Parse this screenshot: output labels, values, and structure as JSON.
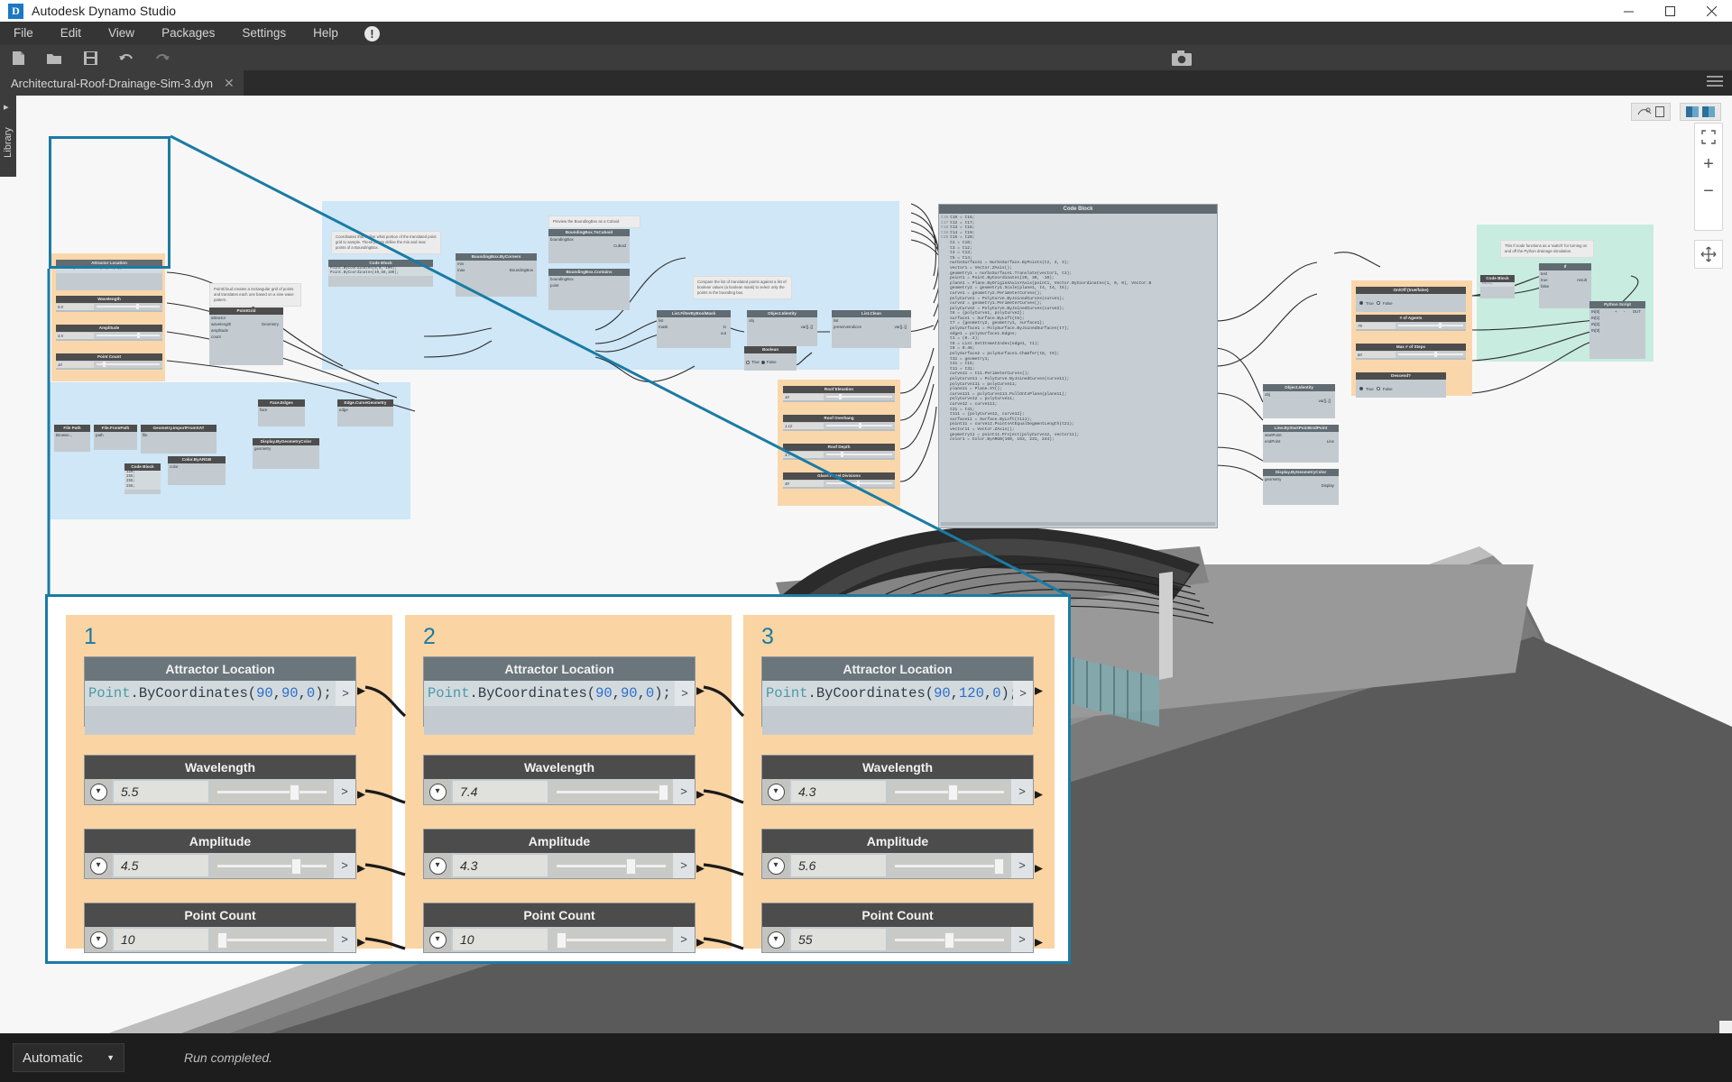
{
  "window": {
    "title": "Autodesk Dynamo Studio",
    "logo_letter": "D",
    "minimize": "─",
    "maximize": "☐",
    "close": "✕"
  },
  "menubar": {
    "items": [
      "File",
      "Edit",
      "View",
      "Packages",
      "Settings",
      "Help"
    ],
    "alert_icon": "!"
  },
  "toolbar": {
    "icons": [
      "new-file-icon",
      "open-folder-icon",
      "save-icon",
      "undo-icon",
      "redo-icon"
    ],
    "camera_icon": "camera-icon"
  },
  "tabbar": {
    "document_name": "Architectural-Roof-Drainage-Sim-3.dyn",
    "close_glyph": "✕"
  },
  "library_panel": {
    "label": "Library",
    "expand_glyph": "▸"
  },
  "canvas": {
    "groups": [
      {
        "name": "attractor-group-1",
        "color": "#fad7ab"
      },
      {
        "name": "sampling-group",
        "color": "#cfe7f7"
      },
      {
        "name": "import-group",
        "color": "#cfe7f7"
      },
      {
        "name": "roof-params-group",
        "color": "#fad7ab"
      },
      {
        "name": "simulation-group",
        "color": "#fad7ab"
      },
      {
        "name": "python-group",
        "color": "#c8ece0"
      }
    ],
    "mini_nodes": {
      "attractor": {
        "code_title": "Attractor Location",
        "code_text": "Point.ByCoordinates(90,90,0);",
        "sliders": [
          {
            "label": "Wavelength",
            "value": "5.5",
            "pct": 62
          },
          {
            "label": "Amplitude",
            "value": "4.5",
            "pct": 64
          },
          {
            "label": "Point Count",
            "value": "10",
            "pct": 10
          }
        ]
      },
      "sampling": {
        "note1": "Coordinates that define what portion of the translated point grid to sample. These points define the min and max points of a BoundingBox.",
        "note2": "Preview the BoundingBox as a Cuboid",
        "note3": "Compare the list of translated points against a list of boolean values (a boolean mask) to select only the points in the bounding box.",
        "code_block_title": "Code Block",
        "code_lines": [
          "Point.ByCoordinates(0,0,-100);",
          "Point.ByCoordinates(40,60,100);"
        ],
        "nodes": [
          {
            "title": "BoundingBox.ByCorners",
            "inputs": [
              "min",
              "max"
            ],
            "outputs": [
              "BoundingBox"
            ]
          },
          {
            "title": "BoundingBox.ToCuboid",
            "inputs": [
              "boundingBox"
            ],
            "outputs": [
              "Cuboid"
            ]
          },
          {
            "title": "BoundingBox.Contains",
            "inputs": [
              "boundingBox",
              "point"
            ],
            "outputs": [
              "bool"
            ]
          },
          {
            "title": "List.FilterByBoolMask",
            "inputs": [
              "list",
              "mask"
            ],
            "outputs": [
              "in",
              "out"
            ]
          },
          {
            "title": "Object.Identity",
            "inputs": [
              "obj"
            ],
            "outputs": [
              "var[]..[]"
            ]
          },
          {
            "title": "List.Clean",
            "inputs": [
              "list",
              "preserveIndices"
            ],
            "outputs": [
              "var[]..[]"
            ]
          },
          {
            "title": "Boolean",
            "inputs": [],
            "outputs": [],
            "options": [
              "True",
              "False"
            ],
            "selected": "False"
          }
        ]
      },
      "import": {
        "note": "PointCloud creates a rectangular grid of points and translates each one based on a sine wave pattern.",
        "nodes": [
          {
            "title": "File Path",
            "rows": [
              "Browse..."
            ]
          },
          {
            "title": "File.FromPath",
            "rows": [
              "path",
              "file"
            ]
          },
          {
            "title": "Geometry.ImportFromSAT",
            "rows": [
              "file",
              "Geometry[]"
            ]
          },
          {
            "title": "Face.Edges",
            "rows": [
              "face",
              "Edge[]"
            ]
          },
          {
            "title": "Edge.CurveGeometry",
            "rows": [
              "edge",
              "Curve"
            ]
          },
          {
            "title": "Display.ByGeometryColor",
            "rows": [
              "geometry",
              "Display",
              "color"
            ]
          },
          {
            "title": "Color.ByARGB",
            "rows": [
              "a",
              "r",
              "g",
              "b",
              "color"
            ]
          },
          {
            "title": "Code Block",
            "rows": [
              "120;",
              "255;",
              "255;",
              "255;"
            ]
          },
          {
            "title": "PointGrid",
            "rows": [
              "attractor",
              "wavelength",
              "amplitude",
              "count",
              "Geometry"
            ]
          },
          {
            "title": "Display.ByGeometryColor",
            "rows": [
              "geometry",
              "color",
              "Display"
            ]
          }
        ]
      },
      "roof_params": {
        "sliders": [
          {
            "label": "Roof Elevation",
            "value": "10",
            "pct": 20
          },
          {
            "label": "Roof Overhang",
            "value": "1.12",
            "pct": 50
          },
          {
            "label": "Roof Depth",
            "value": "3.7",
            "pct": 22
          },
          {
            "label": "Glass Panel Divisions",
            "value": "49",
            "pct": 47
          }
        ]
      },
      "lower_right": [
        {
          "title": "Object.Identity",
          "rows": [
            "obj",
            "var[]..[]"
          ]
        },
        {
          "title": "Line.ByStartPointEndPoint",
          "rows": [
            "startPoint",
            "endPoint",
            "Line"
          ]
        },
        {
          "title": "Display.ByGeometryColor",
          "rows": [
            "geometry",
            "color",
            "Display"
          ]
        }
      ],
      "simulation": {
        "nodes": [
          {
            "title": "On/Off (true/false)",
            "type": "boolean",
            "options": [
              "True",
              "False"
            ],
            "selected": "True"
          },
          {
            "title": "# of Agents",
            "type": "slider",
            "value": "79",
            "pct": 62
          },
          {
            "title": "Max # of Steps",
            "type": "slider",
            "value": "60",
            "pct": 55
          },
          {
            "title": "Descend?",
            "type": "boolean",
            "options": [
              "True",
              "False"
            ],
            "selected": "True"
          }
        ]
      },
      "python": {
        "note": "This If node functions as a 'switch' for turning on and off the Python drainage simulation.",
        "if_node": {
          "title": "If",
          "inputs": [
            "test",
            "true",
            "false"
          ],
          "outputs": [
            "result"
          ]
        },
        "code_block": {
          "title": "Code Block",
          "text": "null;"
        },
        "script_node": {
          "title": "Python Script",
          "inputs": [
            "IN[0]",
            "IN[1]",
            "IN[2]",
            "IN[3]"
          ],
          "outputs": [
            "OUT"
          ],
          "plus": "+",
          "minus": "-"
        }
      }
    },
    "big_code_block": {
      "title": "Code Block",
      "gutter": [
        "t16",
        "t17",
        "t18",
        "t19",
        "t20"
      ],
      "lines": [
        "t10 = t16;",
        "t12 = t17;",
        "t13 = t18;",
        "t14 = t19;",
        "t15 = t20;",
        "t2 = t10;",
        "t3 = t12;",
        "t4 = t13;",
        "t5 = t14;",
        "nurbsSurface1 = NurbsSurface.ByPoints(t2, 3, 3);",
        "vector1 = Vector.ZAxis();",
        "geometry1 = nurbsSurface1.Translate(vector1, t3);",
        "point1 = Point.ByCoordinates(20, 30, -10);",
        "plane1 = Plane.ByOriginXAxisYAxis(point1, Vector.ByCoordinates(1, 0, 0), Vector.B",
        "geometry2 = geometry1.Scale(plane1, t4, t4, t5);",
        "curve1 = geometry2.PerimeterCurves();",
        "polyCurve1 = PolyCurve.ByJoinedCurves(curve1);",
        "curve2 = geometry1.PerimeterCurves();",
        "polyCurve2 = PolyCurve.ByJoinedCurves(curve2);",
        "t6 = {polyCurve1, polyCurve2};",
        "surface1 = Surface.ByLoft(t6);",
        "t7 = {geometry2, geometry1, surface1};",
        "polySurface1 = PolySurface.ByJoinedSurfaces(t7);",
        "edge1 = polySurface1.Edges;",
        "t1 = (0..3);",
        "t8 = List.GetItemAtIndex(edge1, t1);",
        "t9 = 0.46;",
        "polySurface2 = polySurface1.Chamfer(t8, t9);",
        "t31 = geometry1;",
        "t41 = t15;",
        "t11 = t31;",
        "curve11 = t11.PerimeterCurves();",
        "polyCurve11 = PolyCurve.ByJoinedCurves(curve11);",
        "polyCurve111 = polyCurve11;",
        "plane11 = Plane.XY();",
        "curve111 = polyCurve111.PullOntoPlane(plane11);",
        "polyCurve12 = polyCurve11;",
        "curve12 = curve111;",
        "t21 = t41;",
        "t111 = {polyCurve12, curve12};",
        "surface11 = Surface.ByLoft(t111);",
        "point11 = curve12.PointsAtEqualSegmentLength(t21);",
        "vector11 = Vector.ZAxis();",
        "geometry11 = point11.Project(polyCurve12, vector11);",
        "color1 = Color.ByARGB(160, 163, 231, 244);"
      ]
    },
    "zoom_controls": {
      "fit_icon": "fit-to-screen-icon",
      "zoom_in": "+",
      "zoom_out": "−",
      "pan_icon": "pan-icon"
    },
    "top_right_icons": [
      "geometry-view-icon",
      "graph-view-icon",
      "split-view-icon"
    ]
  },
  "detail_panel": {
    "groups": [
      {
        "number": "1",
        "code_node": {
          "title": "Attractor Location",
          "prefix": "Point",
          "dot": ".",
          "method": "ByCoordinates(",
          "x": "90",
          "c1": ",",
          "y": "90",
          "c2": ",",
          "z": "0",
          "suffix": ");",
          "port": ">"
        },
        "sliders": [
          {
            "label": "Wavelength",
            "value": "5.5",
            "pct": 64,
            "port": ">"
          },
          {
            "label": "Amplitude",
            "value": "4.5",
            "pct": 66,
            "port": ">"
          },
          {
            "label": "Point Count",
            "value": "10",
            "pct": 6,
            "port": ">"
          }
        ]
      },
      {
        "number": "2",
        "code_node": {
          "title": "Attractor Location",
          "prefix": "Point",
          "dot": ".",
          "method": "ByCoordinates(",
          "x": "90",
          "c1": ",",
          "y": "90",
          "c2": ",",
          "z": "0",
          "suffix": ");",
          "port": ">"
        },
        "sliders": [
          {
            "label": "Wavelength",
            "value": "7.4",
            "pct": 88,
            "port": ">"
          },
          {
            "label": "Amplitude",
            "value": "4.3",
            "pct": 62,
            "port": ">"
          },
          {
            "label": "Point Count",
            "value": "10",
            "pct": 6,
            "port": ">"
          }
        ]
      },
      {
        "number": "3",
        "code_node": {
          "title": "Attractor Location",
          "prefix": "Point",
          "dot": ".",
          "method": "ByCoordinates(",
          "x": "90",
          "c1": ",",
          "y": "120",
          "c2": ",",
          "z": "0",
          "suffix": ");",
          "port": ">"
        },
        "sliders": [
          {
            "label": "Wavelength",
            "value": "4.3",
            "pct": 49,
            "port": ">"
          },
          {
            "label": "Amplitude",
            "value": "5.6",
            "pct": 86,
            "port": ">"
          },
          {
            "label": "Point Count",
            "value": "55",
            "pct": 46,
            "port": ">"
          }
        ]
      }
    ]
  },
  "statusbar": {
    "run_mode": "Automatic",
    "dropdown_glyph": "▼",
    "run_status": "Run completed."
  },
  "colors": {
    "accent": "#1a7ba4",
    "group_orange": "#fad7ab",
    "group_blue": "#cfe7f7",
    "group_green": "#c8ece0",
    "node_header": "#4c4c4c",
    "chrome_dark": "#353535"
  }
}
